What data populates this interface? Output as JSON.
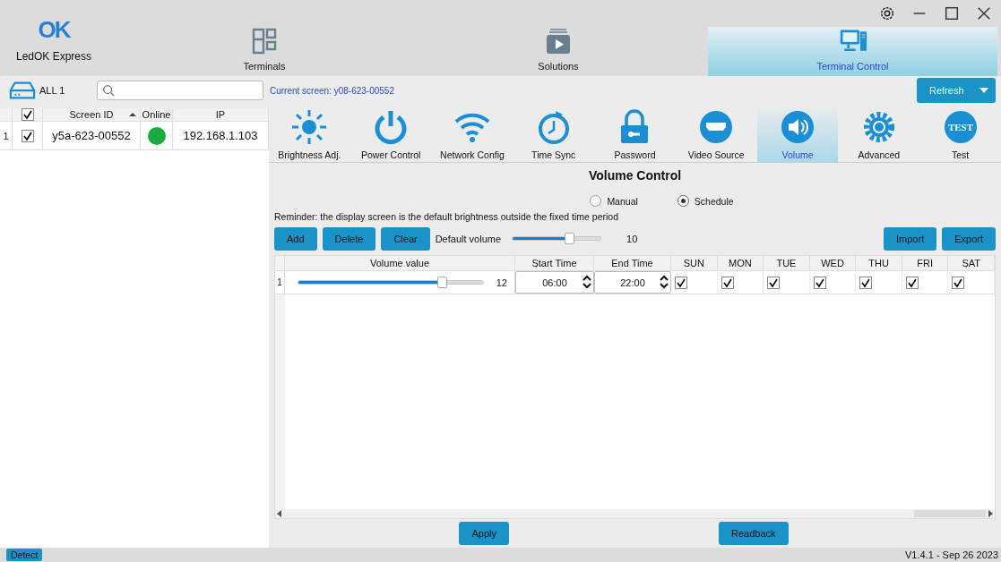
{
  "app": {
    "logo_mark": "OK",
    "name": "LedOK Express"
  },
  "nav_tabs": [
    {
      "label": "Terminals",
      "selected": false
    },
    {
      "label": "Solutions",
      "selected": false
    },
    {
      "label": "Terminal Control",
      "selected": true
    }
  ],
  "screen_list": {
    "all_label": "ALL 1",
    "header_checked": true,
    "columns": [
      "Screen ID",
      "Online",
      "IP"
    ],
    "rows": [
      {
        "index": "1",
        "checked": true,
        "screen_id": "y5a-623-00552",
        "online": true,
        "ip": "192.168.1.103"
      }
    ]
  },
  "current_screen": "Current screen: y08-623-00552",
  "refresh_button": "Refresh",
  "functions": [
    {
      "label": "Brightness Adj.",
      "selected": false
    },
    {
      "label": "Power Control",
      "selected": false
    },
    {
      "label": "Network Config",
      "selected": false
    },
    {
      "label": "Time Sync",
      "selected": false
    },
    {
      "label": "Password",
      "selected": false
    },
    {
      "label": "Video Source",
      "selected": false
    },
    {
      "label": "Volume",
      "selected": true
    },
    {
      "label": "Advanced",
      "selected": false
    },
    {
      "label": "Test",
      "icon_text": "TEST",
      "selected": false
    }
  ],
  "volume": {
    "title": "Volume Control",
    "modes": [
      {
        "label": "Manual",
        "selected": false
      },
      {
        "label": "Schedule",
        "selected": true
      }
    ],
    "reminder": "Reminder: the display screen is the default brightness outside the fixed time period",
    "buttons": [
      "Add",
      "Delete",
      "Clear"
    ],
    "default_volume": {
      "label": "Default volume",
      "level": 0.65,
      "reading": "10"
    },
    "side_buttons": [
      "Import",
      "Export"
    ],
    "columns": [
      "Volume value",
      "Start Time",
      "End Time",
      "SUN",
      "MON",
      "TUE",
      "WED",
      "THU",
      "FRI",
      "SAT"
    ],
    "rows": [
      {
        "index": "1",
        "level": 0.78,
        "reading": "12",
        "start": "06:00",
        "end": "22:00",
        "days": [
          true,
          true,
          true,
          true,
          true,
          true,
          true
        ]
      }
    ]
  },
  "apply_button": "Apply",
  "readback_button": "Readback",
  "status_bar": {
    "detect": "Detect",
    "version": "V1.4.1 - Sep 26 2023"
  }
}
